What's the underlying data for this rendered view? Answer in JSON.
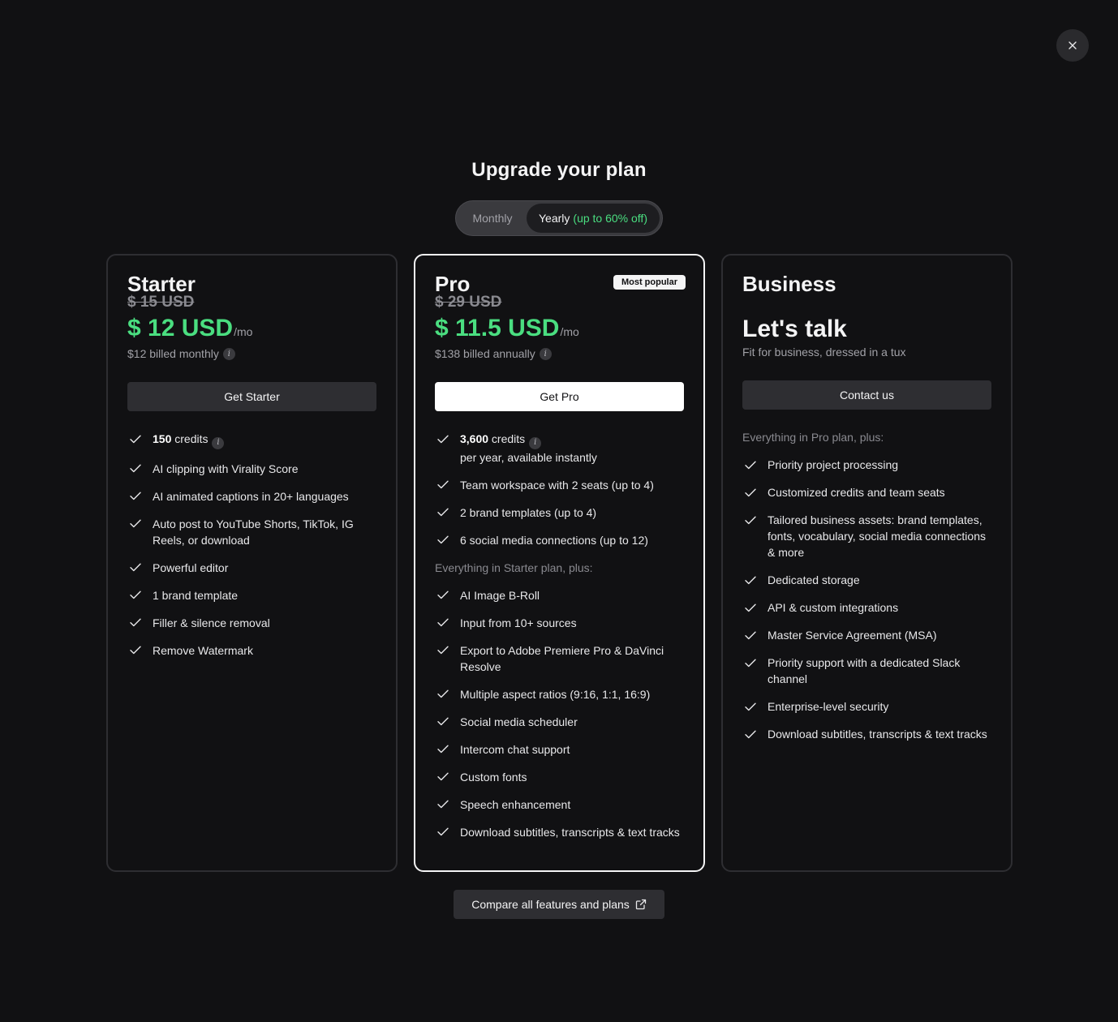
{
  "header": {
    "title": "Upgrade your plan",
    "close_label": "×"
  },
  "billing_toggle": {
    "monthly_label": "Monthly",
    "yearly_label": "Yearly",
    "yearly_discount": "(up to 60% off)",
    "selected": "yearly"
  },
  "plans": {
    "starter": {
      "name": "Starter",
      "old_price": "$ 15 USD",
      "price": "$ 12 USD",
      "per": "/mo",
      "billed_note": "$12 billed monthly",
      "cta": "Get Starter",
      "features": [
        {
          "bold": "150",
          "text": " credits",
          "info": true
        },
        {
          "text": "AI clipping with Virality Score"
        },
        {
          "text": "AI animated captions in 20+ languages"
        },
        {
          "text": "Auto post to YouTube Shorts, TikTok, IG Reels, or download"
        },
        {
          "text": "Powerful editor"
        },
        {
          "text": "1 brand template"
        },
        {
          "text": "Filler & silence removal"
        },
        {
          "text": "Remove Watermark"
        }
      ]
    },
    "pro": {
      "name": "Pro",
      "badge": "Most popular",
      "old_price": "$ 29 USD",
      "price": "$ 11.5 USD",
      "per": "/mo",
      "billed_note": "$138 billed annually",
      "cta": "Get Pro",
      "features_top": [
        {
          "bold": "3,600",
          "text": " credits",
          "info": true,
          "sub": "per year, available instantly"
        },
        {
          "text": "Team workspace with 2 seats (up to 4)"
        },
        {
          "text": "2 brand templates (up to 4)"
        },
        {
          "text": "6 social media connections (up to 12)"
        }
      ],
      "section_note": "Everything in Starter plan, plus:",
      "features_bottom": [
        {
          "text": "AI Image B-Roll"
        },
        {
          "text": "Input from 10+ sources"
        },
        {
          "text": "Export to Adobe Premiere Pro & DaVinci Resolve"
        },
        {
          "text": "Multiple aspect ratios (9:16, 1:1, 16:9)"
        },
        {
          "text": "Social media scheduler"
        },
        {
          "text": "Intercom chat support"
        },
        {
          "text": "Custom fonts"
        },
        {
          "text": "Speech enhancement"
        },
        {
          "text": "Download subtitles, transcripts & text tracks"
        }
      ]
    },
    "business": {
      "name": "Business",
      "headline": "Let's talk",
      "tagline": "Fit for business, dressed in a tux",
      "cta": "Contact us",
      "section_note": "Everything in Pro plan, plus:",
      "features": [
        {
          "text": "Priority project processing"
        },
        {
          "text": "Customized credits and team seats"
        },
        {
          "text": "Tailored business assets: brand templates, fonts, vocabulary, social media connections & more"
        },
        {
          "text": "Dedicated storage"
        },
        {
          "text": "API & custom integrations"
        },
        {
          "text": "Master Service Agreement (MSA)"
        },
        {
          "text": "Priority support with a dedicated Slack channel"
        },
        {
          "text": "Enterprise-level security"
        },
        {
          "text": "Download subtitles, transcripts & text tracks"
        }
      ]
    }
  },
  "footer": {
    "compare_label": "Compare all features and plans"
  },
  "colors": {
    "accent_green": "#4ade80",
    "background": "#111113",
    "card_border": "#2e2e32",
    "highlight_border": "#f4f4f5"
  },
  "icons": {
    "close": "close-icon",
    "check": "check-icon",
    "info": "info-icon",
    "external": "external-link-icon"
  }
}
